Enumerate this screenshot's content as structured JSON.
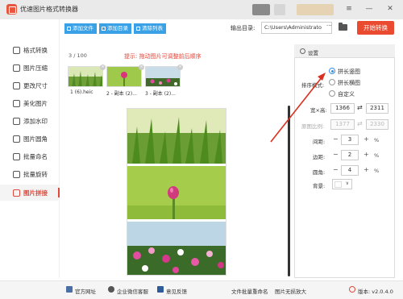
{
  "app": {
    "title": "优速图片格式转换器",
    "window_controls": [
      "≡",
      "—",
      "✕"
    ]
  },
  "sidebar": {
    "items": [
      {
        "label": "格式转换",
        "icon": "convert-icon"
      },
      {
        "label": "图片压缩",
        "icon": "compress-icon"
      },
      {
        "label": "更改尺寸",
        "icon": "resize-icon"
      },
      {
        "label": "美化图片",
        "icon": "beautify-icon"
      },
      {
        "label": "添加水印",
        "icon": "watermark-icon"
      },
      {
        "label": "图片圆角",
        "icon": "round-corner-icon"
      },
      {
        "label": "批量命名",
        "icon": "rename-icon"
      },
      {
        "label": "批量旋转",
        "icon": "rotate-icon"
      },
      {
        "label": "图片拼接",
        "icon": "stitch-icon",
        "active": true
      }
    ]
  },
  "toolbar": {
    "add_file": "添加文件",
    "add_dir": "添加目录",
    "clear_list": "清除列表",
    "output_label": "输出目录:",
    "output_path": "C:\\Users\\Administrato",
    "browse": "···",
    "start": "开始转换"
  },
  "main": {
    "count": "3 / 100",
    "hint": "提示: 拖动图片可调整前后顺序",
    "thumbnails": [
      {
        "label": "1 (6).heic"
      },
      {
        "label": "2 - 副本 (2)..."
      },
      {
        "label": "3 - 副本 (2)..."
      }
    ],
    "thumb_close": "×"
  },
  "settings": {
    "title": "设置",
    "layout_label": "排序模式:",
    "options": [
      {
        "label": "拼长竖图",
        "checked": true
      },
      {
        "label": "拼长横图",
        "checked": false
      },
      {
        "label": "自定义",
        "checked": false
      }
    ],
    "width_height_label": "宽×高:",
    "width": "1366",
    "height": "2311",
    "ratio_label": "原图比例:",
    "ratio_w": "1377",
    "ratio_h": "2330",
    "spacing_label": "间距:",
    "spacing": "3",
    "border_label": "边距:",
    "border": "2",
    "radius_label": "圆角:",
    "radius": "4",
    "bg_label": "背景:",
    "unit": "%",
    "minus": "−",
    "plus": "+",
    "link": "⇄",
    "chevron": "∨"
  },
  "footer": {
    "website": "官方网址",
    "wechat": "企业微信客服",
    "feedback": "意见反馈",
    "batch_rename": "文件批量重命名",
    "lossless": "图片无损放大",
    "version": "版本: v2.0.4.0"
  },
  "colors": {
    "accent_red": "#ea4b30",
    "toolbar_blue": "#3aa1e6",
    "radio_blue": "#3a8ee6"
  }
}
